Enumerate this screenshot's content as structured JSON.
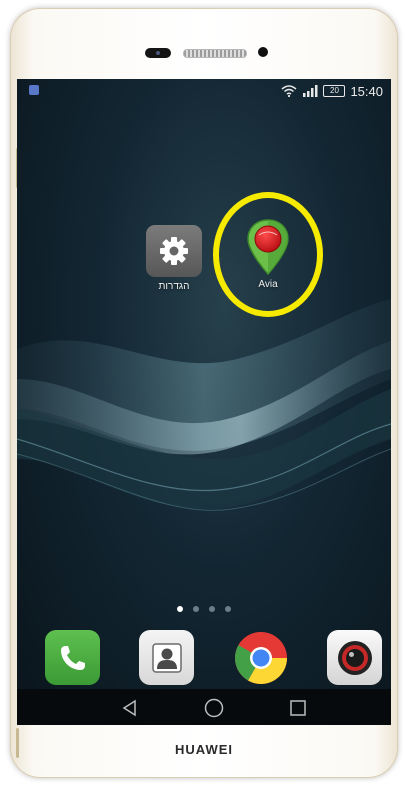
{
  "device": {
    "brand": "HUAWEI"
  },
  "statusbar": {
    "battery": "20",
    "time": "15:40",
    "icons": [
      "notification-icon",
      "wifi-icon",
      "signal-icon",
      "battery-icon"
    ]
  },
  "home": {
    "apps": [
      {
        "label": "הגדרות",
        "icon": "gear-icon"
      },
      {
        "label": "Avia",
        "icon": "map-pin-icon"
      }
    ],
    "highlight_color": "#f5ea00",
    "pages": {
      "count": 4,
      "current": 1
    }
  },
  "dock": {
    "apps": [
      {
        "icon": "phone-icon",
        "color": "#4caf50"
      },
      {
        "icon": "contacts-icon",
        "color": "#e8e8e8"
      },
      {
        "icon": "chrome-icon",
        "color": "#4285f4"
      },
      {
        "icon": "camera-icon",
        "color": "#f0f0f0"
      }
    ]
  },
  "navbar": {
    "icons": [
      "back-icon",
      "home-icon",
      "recents-icon"
    ]
  }
}
